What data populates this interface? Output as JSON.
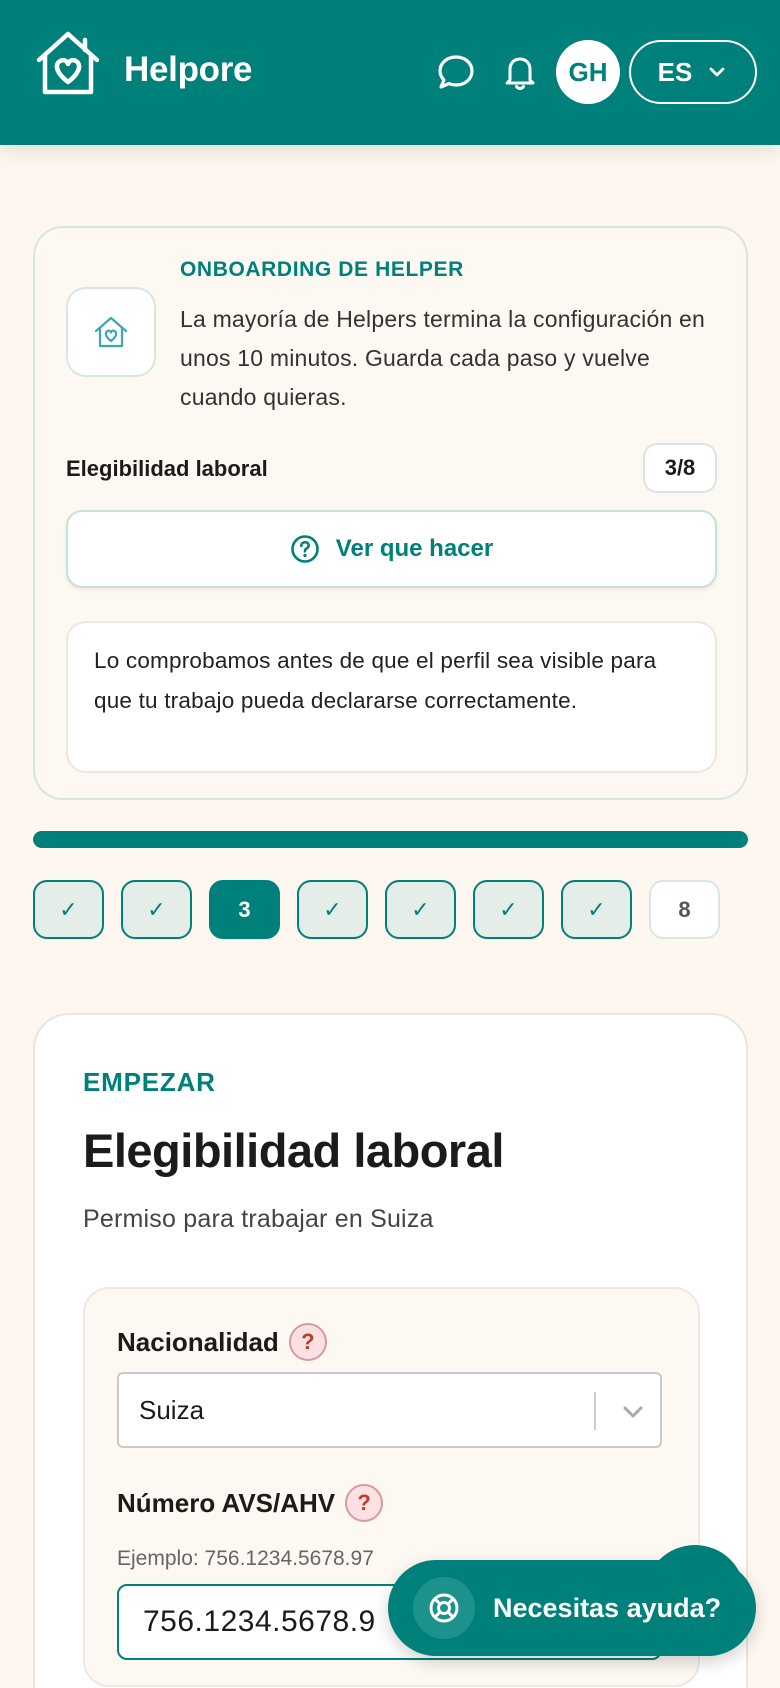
{
  "header": {
    "brand": "Helpore",
    "avatar_initials": "GH",
    "language": "ES",
    "icons": [
      "house-heart-icon",
      "chat-icon",
      "bell-icon",
      "chevron-down-icon"
    ]
  },
  "onboarding": {
    "kicker": "ONBOARDING DE HELPER",
    "description": "La mayoría de Helpers termina la configuración en unos 10 minutos. Guarda cada paso y vuelve cuando quieras.",
    "step_title": "Elegibilidad laboral",
    "step_count": "3/8",
    "help_button": "Ver que hacer",
    "note": "Lo comprobamos antes de que el perfil sea visible para que tu trabajo pueda declararse correctamente."
  },
  "progress": {
    "fraction": 1.0,
    "steps": [
      {
        "label": "✓",
        "state": "done"
      },
      {
        "label": "✓",
        "state": "done"
      },
      {
        "label": "3",
        "state": "current"
      },
      {
        "label": "✓",
        "state": "done"
      },
      {
        "label": "✓",
        "state": "done"
      },
      {
        "label": "✓",
        "state": "done"
      },
      {
        "label": "✓",
        "state": "done"
      },
      {
        "label": "8",
        "state": "todo"
      }
    ]
  },
  "main": {
    "kicker": "EMPEZAR",
    "title": "Elegibilidad laboral",
    "subtitle": "Permiso para trabajar en Suiza",
    "nationality_label": "Nacionalidad",
    "nationality_value": "Suiza",
    "avs_label": "Número AVS/AHV",
    "avs_hint": "Ejemplo: 756.1234.5678.97",
    "avs_value": "756.1234.5678.9",
    "help_mark": "?"
  },
  "fab": {
    "label": "Necesitas ayuda?"
  },
  "colors": {
    "brand": "#00807a",
    "background": "#fdf7f0",
    "help_mark": "#c0392b"
  }
}
